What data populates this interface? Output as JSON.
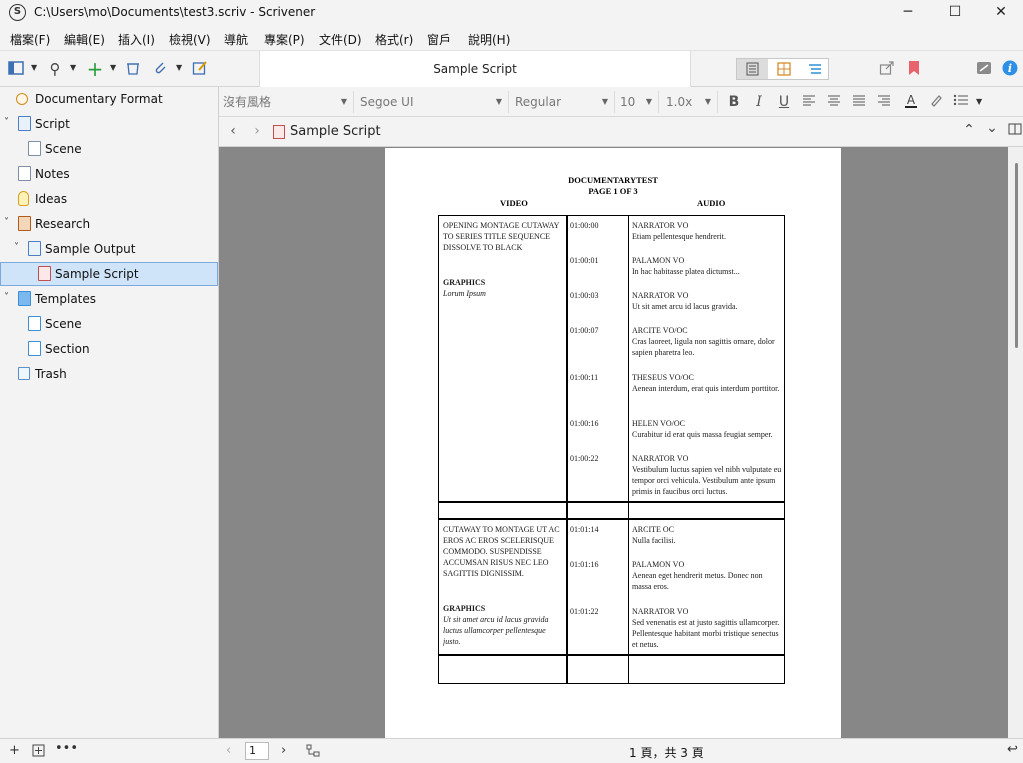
{
  "window": {
    "title": "C:\\Users\\mo\\Documents\\test3.scriv - Scrivener",
    "app_icon": "S",
    "min_glyph": "─",
    "max_glyph": "☐",
    "close_glyph": "✕"
  },
  "menu": [
    "檔案(F)",
    "編輯(E)",
    "插入(I)",
    "檢視(V)",
    "導航",
    "專案(P)",
    "文件(D)",
    "格式(r)",
    "窗戶",
    "說明(H)"
  ],
  "toolbar": {
    "document_title": "Sample Script"
  },
  "binder": [
    {
      "label": "Documentary Format",
      "chevron": "",
      "icon": "bulb"
    },
    {
      "label": "Script",
      "chevron": "˅",
      "icon": "doc"
    },
    {
      "label": "Scene",
      "chevron": "",
      "icon": "doc"
    },
    {
      "label": "Notes",
      "chevron": "",
      "icon": "doc"
    },
    {
      "label": "Ideas",
      "chevron": "",
      "icon": "bulb"
    },
    {
      "label": "Research",
      "chevron": "˅",
      "icon": "folder"
    },
    {
      "label": "Sample Output",
      "chevron": "˅",
      "icon": "doc"
    },
    {
      "label": "Sample Script",
      "chevron": "",
      "icon": "doc"
    },
    {
      "label": "Templates",
      "chevron": "˅",
      "icon": "folder"
    },
    {
      "label": "Scene",
      "chevron": "",
      "icon": "doc"
    },
    {
      "label": "Section",
      "chevron": "",
      "icon": "doc"
    },
    {
      "label": "Trash",
      "chevron": "",
      "icon": "trash"
    }
  ],
  "formatbar": {
    "style": "沒有風格",
    "font": "Segoe UI",
    "weight": "Regular",
    "size": "10",
    "line_spacing": "1.0x"
  },
  "header": {
    "title": "Sample Script"
  },
  "script_page": {
    "title": "DOCUMENTARYTEST",
    "page_label": "PAGE 1 OF 3",
    "video_head": "VIDEO",
    "audio_head": "AUDIO",
    "block1_video": "OPENING MONTAGE CUTAWAY TO SERIES TITLE SEQUENCE DISSOLVE TO BLACK",
    "block1_graphics_head": "GRAPHICS",
    "block1_graphics": "Lorum Ipsum",
    "block1_entries": [
      {
        "time": "01:00:00",
        "who": "NARRATOR VO",
        "text": "Etiam pellentesque hendrerit."
      },
      {
        "time": "01:00:01",
        "who": "PALAMON VO",
        "text": "In hac habitasse platea dictumst..."
      },
      {
        "time": "01:00:03",
        "who": "NARRATOR VO",
        "text": "Ut sit amet arcu id lacus gravida."
      },
      {
        "time": "01:00:07",
        "who": "ARCITE VO/OC",
        "text": "Cras laoreet, ligula non sagittis ornare, dolor sapien pharetra leo."
      },
      {
        "time": "01:00:11",
        "who": "THESEUS VO/OC",
        "text": "Aenean interdum, erat quis interdum porttitor."
      },
      {
        "time": "01:00:16",
        "who": "HELEN VO/OC",
        "text": "Curabitur id erat quis massa feugiat semper."
      },
      {
        "time": "01:00:22",
        "who": "NARRATOR VO",
        "text": "Vestibulum luctus sapien vel nibh vulputate eu tempor orci vehicula. Vestibulum ante ipsum primis in faucibus orci luctus."
      }
    ],
    "block2_video": "CUTAWAY TO MONTAGE UT AC EROS AC EROS SCELERISQUE COMMODO. SUSPENDISSE ACCUMSAN RISUS NEC LEO SAGITTIS DIGNISSIM.",
    "block2_graphics_head": "GRAPHICS",
    "block2_graphics": "Ut sit amet arcu id lacus gravida luctus ullamcorper pellentesque justo.",
    "block2_entries": [
      {
        "time": "01:01:14",
        "who": "ARCITE OC",
        "text": "Nulla facilisi."
      },
      {
        "time": "01:01:16",
        "who": "PALAMON VO",
        "text": "Aenean eget hendrerit metus. Donec non massa eros."
      },
      {
        "time": "01:01:22",
        "who": "NARRATOR VO",
        "text": "Sed venenatis est at justo sagittis ullamcorper. Pellentesque habitant morbi tristique senectus et netus."
      }
    ]
  },
  "footer": {
    "page_number": "1",
    "page_count": "1 頁，共 3 頁"
  }
}
